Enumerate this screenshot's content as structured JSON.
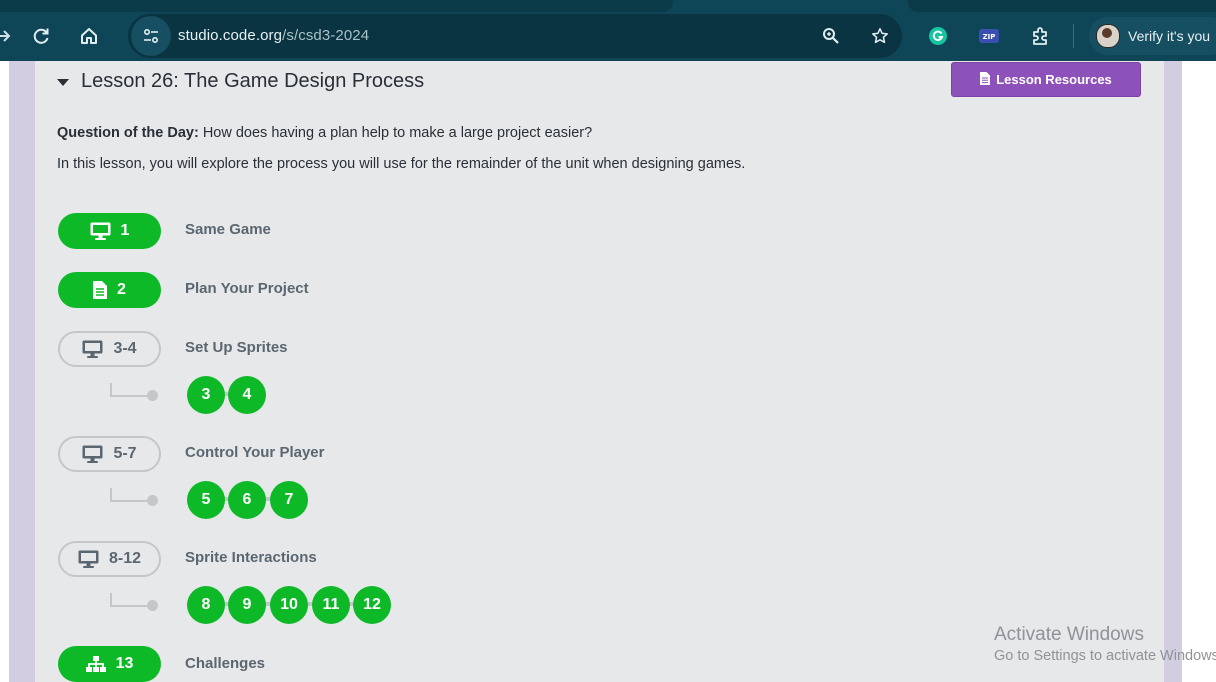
{
  "browser": {
    "url_host": "studio.code.org",
    "url_path": "/s/csd3-2024",
    "profile_label": "Verify it's you",
    "extension_zip_label": "ZIP"
  },
  "lesson": {
    "title": "Lesson 26: The Game Design Process",
    "resources_label": "Lesson Resources",
    "qotd_label": "Question of the Day:",
    "qotd_text": " How does having a plan help to make a large project easier?",
    "overview": "In this lesson, you will explore the process you will use for the remainder of the unit when designing games."
  },
  "levels": [
    {
      "pill": "1",
      "label": "Same Game",
      "icon": "desktop-icon",
      "status": "completed"
    },
    {
      "pill": "2",
      "label": "Plan Your Project",
      "icon": "document-icon",
      "status": "completed"
    },
    {
      "pill": "3-4",
      "label": "Set Up Sprites",
      "icon": "desktop-icon",
      "status": "in-progress",
      "bubbles": [
        "3",
        "4"
      ]
    },
    {
      "pill": "5-7",
      "label": "Control Your Player",
      "icon": "desktop-icon",
      "status": "in-progress",
      "bubbles": [
        "5",
        "6",
        "7"
      ]
    },
    {
      "pill": "8-12",
      "label": "Sprite Interactions",
      "icon": "desktop-icon",
      "status": "in-progress",
      "bubbles": [
        "8",
        "9",
        "10",
        "11",
        "12"
      ]
    },
    {
      "pill": "13",
      "label": "Challenges",
      "icon": "sitemap-icon",
      "status": "completed"
    }
  ],
  "watermark": {
    "line1": "Activate Windows",
    "line2": "Go to Settings to activate Windows."
  },
  "colors": {
    "toolbar": "#0f4657",
    "completed_green": "#0eb928",
    "resources_purple": "#8c52ba",
    "card_bg": "#e7e8ea",
    "side_lilac": "#d3cde2"
  }
}
